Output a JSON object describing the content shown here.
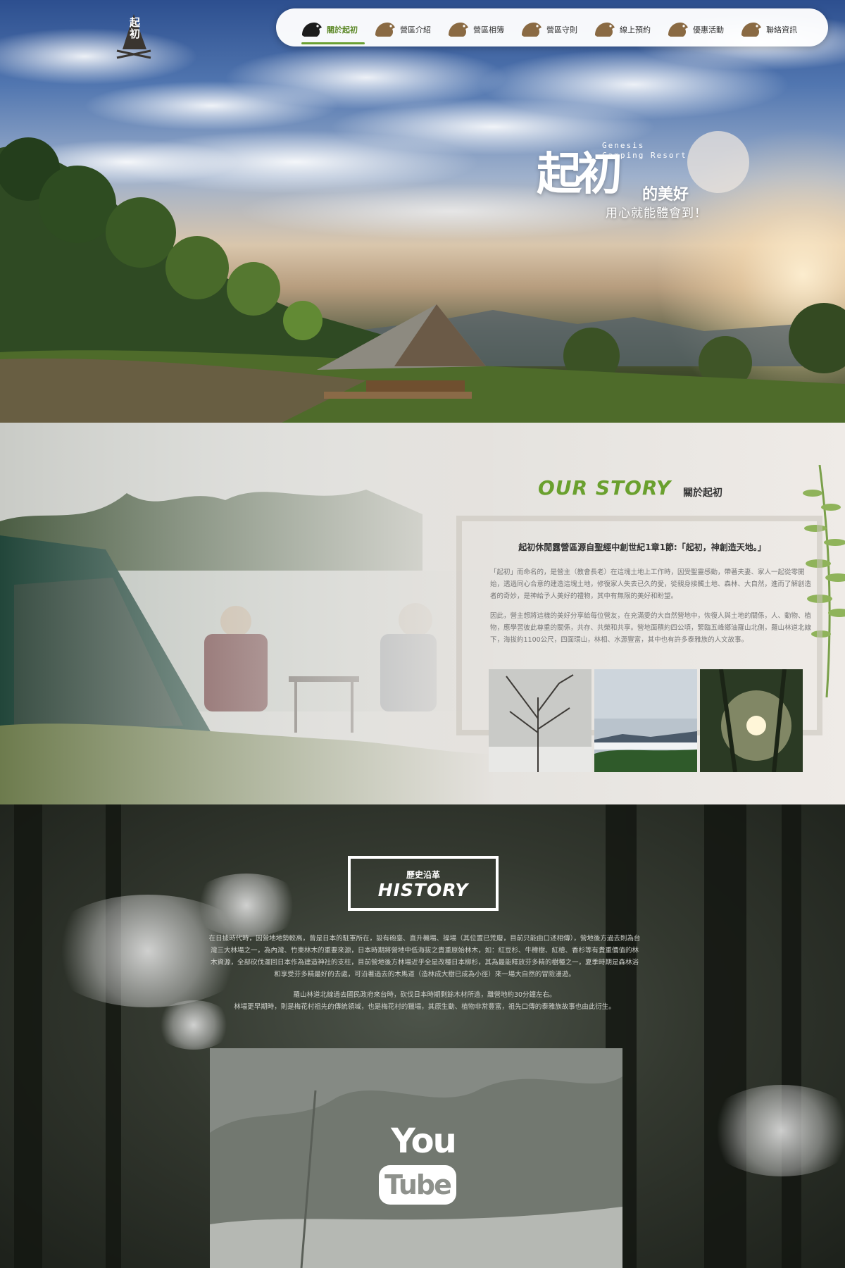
{
  "brand": {
    "logo_text": "起初"
  },
  "nav": {
    "items": [
      {
        "label": "關於起初",
        "active": true
      },
      {
        "label": "營區介紹",
        "active": false
      },
      {
        "label": "營區相簿",
        "active": false
      },
      {
        "label": "營區守則",
        "active": false
      },
      {
        "label": "線上預約",
        "active": false
      },
      {
        "label": "優惠活動",
        "active": false
      },
      {
        "label": "聯絡資訊",
        "active": false
      }
    ],
    "accent_color": "#6ba033",
    "icon_color": "#8a6a43"
  },
  "hero": {
    "title_main": "起初",
    "title_tail": "的美好",
    "subtitle": "用心就能體會到！",
    "en_line1": "Genesis",
    "en_line2": "Camping Resort"
  },
  "story": {
    "title_en": "OUR STORY",
    "title_zh": "關於起初",
    "heading": "起初休閒露營區源自聖經中創世紀1章1節:「起初，神創造天地。」",
    "paragraph1": "「起初」而命名的，是營主（教會長老）在這塊土地上工作時，因受聖靈感動，帶著夫妻、家人一起從零開始，透過同心合意的建造這塊土地，修復家人失去已久的愛，從親身接觸土地、森林、大自然，進而了解創造者的奇妙，是神給予人美好的禮物，其中有無限的美好和盼望。",
    "paragraph2": "因此，營主想將這樣的美好分享給每位營友，在充滿愛的大自然營地中，恢復人與土地的關係，人、動物、植物，應學習彼此尊重的關係，共存、共榮和共享。營地面積約四公頃，緊臨五峰鄉油羅山北側，羅山林道北線下，海拔約1100公尺，四面環山，林相、水源豐富，其中也有許多泰雅族的人文故事。",
    "thumbnails": [
      {
        "icon": "snowy-tree-photo"
      },
      {
        "icon": "sea-of-clouds-photo"
      },
      {
        "icon": "forest-sunlight-photo"
      }
    ]
  },
  "history": {
    "title_zh": "歷史沿革",
    "title_en": "HISTORY",
    "paragraph1": "在日據時代時，因營地地勢較高，曾是日本的駐軍所在，設有砲臺、直升機場、操場（其位置已荒廢，目前只能由口述相傳），營地後方過去則為台灣三大林場之一，為內灣、竹東林木的重要來源，日本時期將營地中低海拔之貴重原始林木，如：紅豆杉、牛樟樹、紅檜、香杉等有貴重價值的林木資源，全部砍伐運回日本作為建造神社的支柱，目前營地後方林場近乎全是改種日本柳杉，其為最能釋放芬多精的樹種之一，夏季時期是森林浴和享受芬多精最好的去處，可沿著過去的木馬道（造林成大樹已成為小徑）來一場大自然的冒險漫遊。",
    "paragraph2a": "羅山林道北線過去國民政府來台時，砍伐日本時期剩餘木材所造，離營地約30分鐘左右。",
    "paragraph2b": "林場更早期時，則是梅花村祖先的傳統領域，也是梅花村的獵場，其原生動、植物非常豐富，祖先口傳的泰雅族故事也由此衍生。",
    "video": {
      "you": "You",
      "tube": "Tube",
      "icon": "youtube-logo-icon"
    }
  }
}
